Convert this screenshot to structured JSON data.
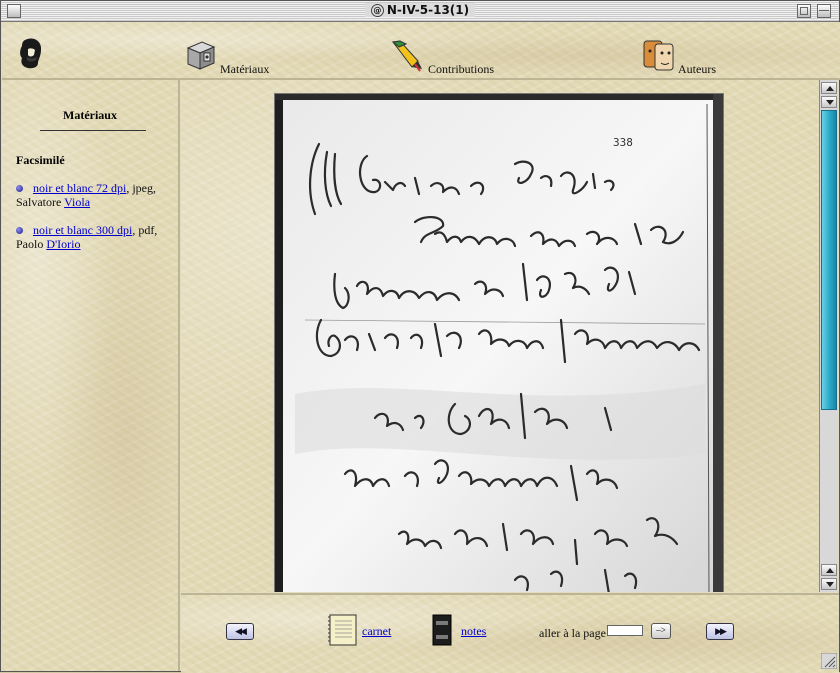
{
  "window": {
    "title": "N-IV-5-13(1)"
  },
  "nav": [
    {
      "label": "Matériaux",
      "icon": "materials-box-icon"
    },
    {
      "label": "Contributions",
      "icon": "pen-icon"
    },
    {
      "label": "Auteurs",
      "icon": "authors-faces-icon"
    }
  ],
  "sidebar": {
    "title": "Matériaux",
    "section": "Facsimilé",
    "entries": [
      {
        "link": "noir et blanc 72 dpi",
        "format": ", jpeg,",
        "contributor_prefix": "Salvatore ",
        "contributor_link": "Viola"
      },
      {
        "link": "noir et blanc 300 dpi",
        "format": ", pdf,",
        "contributor_prefix": "Paolo ",
        "contributor_link": "D'Iorio"
      }
    ]
  },
  "page": {
    "number_mark": "338"
  },
  "footer": {
    "prev_label": "◀◀",
    "next_label": "▶▶",
    "carnet": "carnet",
    "notes": "notes",
    "goto_label": "aller à la page",
    "goto_value": "",
    "go_button": "–>"
  }
}
